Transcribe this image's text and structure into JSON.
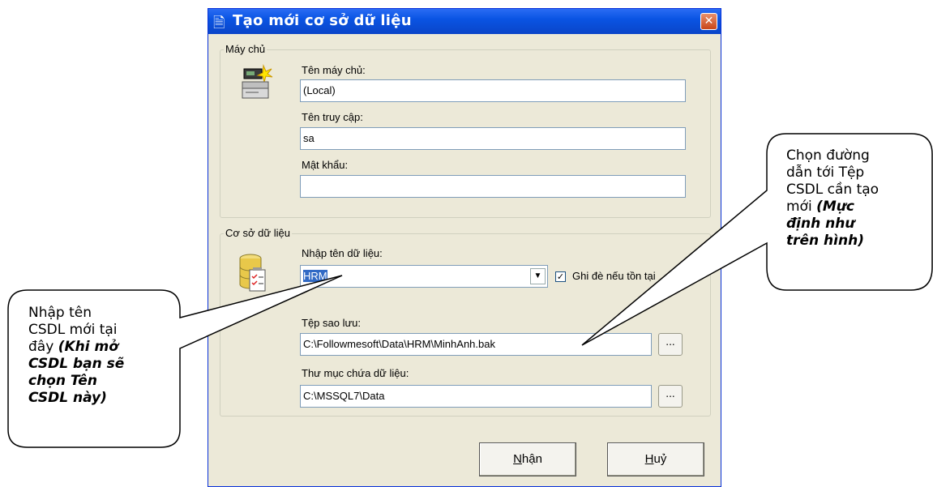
{
  "dialog": {
    "title": "Tạo mới cơ sở dữ liệu",
    "close_label": "✕"
  },
  "server_group": {
    "legend": "Máy chủ",
    "server_name_label": "Tên máy chủ:",
    "server_name_value": "(Local)",
    "login_label": "Tên truy cập:",
    "login_value": "sa",
    "password_label": "Mật khẩu:",
    "password_value": ""
  },
  "database_group": {
    "legend": "Cơ sở dữ liệu",
    "db_name_label": "Nhập tên dữ liệu:",
    "db_name_value": "HRM",
    "overwrite_label": "Ghi đè nếu tồn tại",
    "overwrite_checked": true,
    "backup_file_label": "Tệp sao lưu:",
    "backup_file_value": "C:\\Followmesoft\\Data\\HRM\\MinhAnh.bak",
    "data_folder_label": "Thư mục chứa dữ liệu:",
    "data_folder_value": "C:\\MSSQL7\\Data",
    "browse_label": "..."
  },
  "buttons": {
    "ok_underlined": "N",
    "ok_rest": "hận",
    "cancel_underlined": "H",
    "cancel_rest": "uỷ"
  },
  "callouts": {
    "left_normal": [
      "Nhập tên",
      "CSDL mới tại",
      "đây "
    ],
    "left_bold": [
      "(Khi mở",
      "CSDL bạn sẽ",
      "chọn Tên",
      "CSDL này)"
    ],
    "right_normal": [
      "Chọn đường",
      "dẫn tới Tệp",
      "CSDL cần tạo",
      "mới "
    ],
    "right_bold": [
      "(Mực",
      "định như",
      "trên hình)"
    ]
  },
  "icons": {
    "server": "server-computer-icon",
    "database": "database-icon",
    "title": "new-document-icon"
  }
}
